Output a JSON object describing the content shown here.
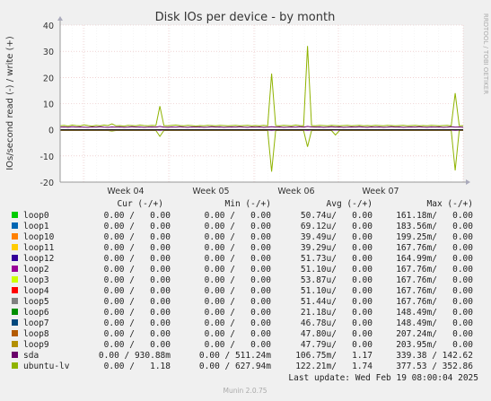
{
  "chart_data": {
    "type": "line",
    "title": "Disk IOs per device - by month",
    "ylabel": "IOs/second read (-) / write (+)",
    "side_label": "RRDTOOL / TOBI OETIKER",
    "y_ticks": [
      "40",
      "30",
      "20",
      "10",
      "0",
      "-10",
      "-20"
    ],
    "ylim": [
      -20,
      40
    ],
    "x_ticks": [
      "Week 04",
      "Week 05",
      "Week 06",
      "Week 07"
    ],
    "legend_header": {
      "cur": "Cur (-/+)",
      "min": "Min (-/+)",
      "avg": "Avg (-/+)",
      "max": "Max (-/+)"
    },
    "rows": [
      {
        "name": "loop0",
        "color": "#00cc00",
        "cur": "0.00 /   0.00",
        "min": "0.00 /   0.00",
        "avg": "50.74u/   0.00",
        "max": "161.18m/   0.00"
      },
      {
        "name": "loop1",
        "color": "#0066b3",
        "cur": "0.00 /   0.00",
        "min": "0.00 /   0.00",
        "avg": "69.12u/   0.00",
        "max": "183.56m/   0.00"
      },
      {
        "name": "loop10",
        "color": "#ff8000",
        "cur": "0.00 /   0.00",
        "min": "0.00 /   0.00",
        "avg": "39.49u/   0.00",
        "max": "199.25m/   0.00"
      },
      {
        "name": "loop11",
        "color": "#ffcc00",
        "cur": "0.00 /   0.00",
        "min": "0.00 /   0.00",
        "avg": "39.29u/   0.00",
        "max": "167.76m/   0.00"
      },
      {
        "name": "loop12",
        "color": "#330099",
        "cur": "0.00 /   0.00",
        "min": "0.00 /   0.00",
        "avg": "51.73u/   0.00",
        "max": "164.99m/   0.00"
      },
      {
        "name": "loop2",
        "color": "#990099",
        "cur": "0.00 /   0.00",
        "min": "0.00 /   0.00",
        "avg": "51.10u/   0.00",
        "max": "167.76m/   0.00"
      },
      {
        "name": "loop3",
        "color": "#ccff00",
        "cur": "0.00 /   0.00",
        "min": "0.00 /   0.00",
        "avg": "53.87u/   0.00",
        "max": "167.76m/   0.00"
      },
      {
        "name": "loop4",
        "color": "#ff0000",
        "cur": "0.00 /   0.00",
        "min": "0.00 /   0.00",
        "avg": "51.10u/   0.00",
        "max": "167.76m/   0.00"
      },
      {
        "name": "loop5",
        "color": "#808080",
        "cur": "0.00 /   0.00",
        "min": "0.00 /   0.00",
        "avg": "51.44u/   0.00",
        "max": "167.76m/   0.00"
      },
      {
        "name": "loop6",
        "color": "#008f00",
        "cur": "0.00 /   0.00",
        "min": "0.00 /   0.00",
        "avg": "21.18u/   0.00",
        "max": "148.49m/   0.00"
      },
      {
        "name": "loop7",
        "color": "#00487d",
        "cur": "0.00 /   0.00",
        "min": "0.00 /   0.00",
        "avg": "46.78u/   0.00",
        "max": "148.49m/   0.00"
      },
      {
        "name": "loop8",
        "color": "#b35a00",
        "cur": "0.00 /   0.00",
        "min": "0.00 /   0.00",
        "avg": "47.80u/   0.00",
        "max": "207.24m/   0.00"
      },
      {
        "name": "loop9",
        "color": "#b38f00",
        "cur": "0.00 /   0.00",
        "min": "0.00 /   0.00",
        "avg": "47.79u/   0.00",
        "max": "203.95m/   0.00"
      },
      {
        "name": "sda",
        "color": "#6b006b",
        "cur": "0.00 / 930.88m",
        "min": "0.00 / 511.24m",
        "avg": "106.75m/   1.17",
        "max": "339.38 / 142.62"
      },
      {
        "name": "ubuntu-lv",
        "color": "#8fb300",
        "cur": "0.00 /   1.18",
        "min": "0.00 / 627.94m",
        "avg": "122.21m/   1.74",
        "max": "377.53 / 352.86"
      }
    ],
    "series": [
      {
        "name": "ubuntu-lv",
        "color": "#8fb300",
        "write": [
          1.5,
          1.7,
          1.4,
          1.8,
          1.6,
          1.5,
          1.9,
          1.6,
          1.4,
          1.7,
          1.5,
          1.8,
          1.6,
          2.3,
          1.5,
          1.6,
          1.4,
          1.7,
          1.6,
          1.5,
          1.8,
          1.6,
          1.5,
          1.7,
          1.6,
          9.0,
          1.6,
          1.5,
          1.7,
          1.8,
          1.6,
          1.5,
          1.7,
          1.6,
          1.4,
          1.6,
          1.5,
          1.7,
          1.6,
          1.5,
          1.7,
          1.6,
          1.5,
          1.6,
          1.7,
          1.5,
          1.6,
          1.7,
          1.5,
          1.6,
          1.5,
          1.7,
          1.5,
          21.5,
          1.6,
          1.5,
          1.7,
          1.6,
          1.5,
          1.8,
          1.6,
          1.5,
          32.0,
          1.6,
          1.5,
          1.7,
          1.6,
          1.5,
          1.7,
          1.6,
          1.5,
          1.6,
          1.7,
          1.5,
          1.6,
          1.7,
          1.5,
          1.6,
          1.5,
          1.7,
          1.6,
          1.5,
          1.7,
          1.6,
          1.5,
          1.6,
          1.7,
          1.5,
          1.6,
          1.7,
          1.5,
          1.6,
          1.5,
          1.7,
          1.6,
          1.5,
          1.6,
          1.7,
          1.5,
          14.0,
          1.6,
          1.5
        ],
        "read": [
          -0.3,
          -0.3,
          -0.3,
          -0.3,
          -0.3,
          -0.3,
          -0.3,
          -0.3,
          -0.3,
          -0.3,
          -0.3,
          -0.3,
          -0.3,
          -0.5,
          -0.3,
          -0.3,
          -0.3,
          -0.3,
          -0.3,
          -0.3,
          -0.3,
          -0.3,
          -0.3,
          -0.3,
          -0.3,
          -2.5,
          -0.3,
          -0.3,
          -0.3,
          -0.3,
          -0.3,
          -0.3,
          -0.3,
          -0.3,
          -0.3,
          -0.3,
          -0.3,
          -0.3,
          -0.3,
          -0.3,
          -0.3,
          -0.3,
          -0.3,
          -0.3,
          -0.3,
          -0.3,
          -0.3,
          -0.3,
          -0.3,
          -0.3,
          -0.3,
          -0.3,
          -0.3,
          -16.0,
          -0.3,
          -0.3,
          -0.3,
          -0.3,
          -0.3,
          -0.3,
          -0.3,
          -0.3,
          -6.5,
          -0.3,
          -0.3,
          -0.3,
          -0.3,
          -0.3,
          -0.3,
          -2.0,
          -0.3,
          -0.3,
          -0.3,
          -0.3,
          -0.3,
          -0.3,
          -0.3,
          -0.3,
          -0.3,
          -0.3,
          -0.3,
          -0.3,
          -0.3,
          -0.3,
          -0.3,
          -0.3,
          -0.3,
          -0.3,
          -0.3,
          -0.3,
          -0.3,
          -0.3,
          -0.3,
          -0.3,
          -0.3,
          -0.3,
          -0.3,
          -0.3,
          -0.3,
          -15.5,
          -0.3,
          -0.3
        ]
      },
      {
        "name": "sda",
        "color": "#6b006b",
        "write": [
          1.0,
          1.1,
          0.9,
          1.2,
          1.0,
          1.1,
          1.0,
          0.9,
          1.1,
          1.0,
          1.2,
          1.0,
          0.9,
          1.1,
          1.0,
          1.1,
          0.9,
          1.0,
          1.2,
          1.0,
          1.1,
          0.9,
          1.0,
          1.1,
          1.0,
          1.3,
          1.0,
          0.9,
          1.1,
          1.0,
          1.2,
          1.0,
          0.9,
          1.1,
          1.0,
          1.1,
          0.9,
          1.0,
          1.2,
          1.0,
          1.1,
          0.9,
          1.0,
          1.1,
          1.0,
          1.2,
          1.0,
          0.9,
          1.1,
          1.0,
          1.1,
          0.9,
          1.0,
          1.2,
          1.0,
          1.1,
          0.9,
          1.0,
          1.1,
          1.0,
          1.2,
          1.0,
          1.3,
          1.1,
          1.0,
          1.1,
          0.9,
          1.0,
          1.2,
          1.0,
          1.1,
          0.9,
          1.0,
          1.1,
          1.0,
          1.2,
          1.0,
          0.9,
          1.1,
          1.0,
          1.1,
          0.9,
          1.0,
          1.2,
          1.0,
          1.1,
          0.9,
          1.0,
          1.1,
          1.0,
          1.2,
          1.0,
          0.9,
          1.1,
          1.0,
          1.1,
          0.9,
          1.0,
          1.2,
          1.0,
          1.1,
          0.9
        ],
        "read": [
          -0.1,
          -0.1,
          -0.1,
          -0.1,
          -0.1,
          -0.1,
          -0.1,
          -0.1,
          -0.1,
          -0.1,
          -0.1,
          -0.1,
          -0.1,
          -0.1,
          -0.1,
          -0.1,
          -0.1,
          -0.1,
          -0.1,
          -0.1,
          -0.1,
          -0.1,
          -0.1,
          -0.1,
          -0.1,
          -0.2,
          -0.1,
          -0.1,
          -0.1,
          -0.1,
          -0.1,
          -0.1,
          -0.1,
          -0.1,
          -0.1,
          -0.1,
          -0.1,
          -0.1,
          -0.1,
          -0.1,
          -0.1,
          -0.1,
          -0.1,
          -0.1,
          -0.1,
          -0.1,
          -0.1,
          -0.1,
          -0.1,
          -0.1,
          -0.1,
          -0.1,
          -0.1,
          -0.2,
          -0.1,
          -0.1,
          -0.1,
          -0.1,
          -0.1,
          -0.1,
          -0.1,
          -0.1,
          -0.2,
          -0.1,
          -0.1,
          -0.1,
          -0.1,
          -0.1,
          -0.1,
          -0.1,
          -0.1,
          -0.1,
          -0.1,
          -0.1,
          -0.1,
          -0.1,
          -0.1,
          -0.1,
          -0.1,
          -0.1,
          -0.1,
          -0.1,
          -0.1,
          -0.1,
          -0.1,
          -0.1,
          -0.1,
          -0.1,
          -0.1,
          -0.1,
          -0.1,
          -0.1,
          -0.1,
          -0.1,
          -0.1,
          -0.1,
          -0.1,
          -0.1,
          -0.1,
          -0.2,
          -0.1,
          -0.1
        ]
      }
    ]
  },
  "footer": {
    "last_update": "Last update:  Wed Feb 19 08:00:04 2025",
    "munin": "Munin 2.0.75"
  },
  "colors": {
    "background": "#f0f0f0",
    "plot_bg": "#ffffff",
    "grid": "#e0b0b0",
    "axis": "#888888"
  }
}
